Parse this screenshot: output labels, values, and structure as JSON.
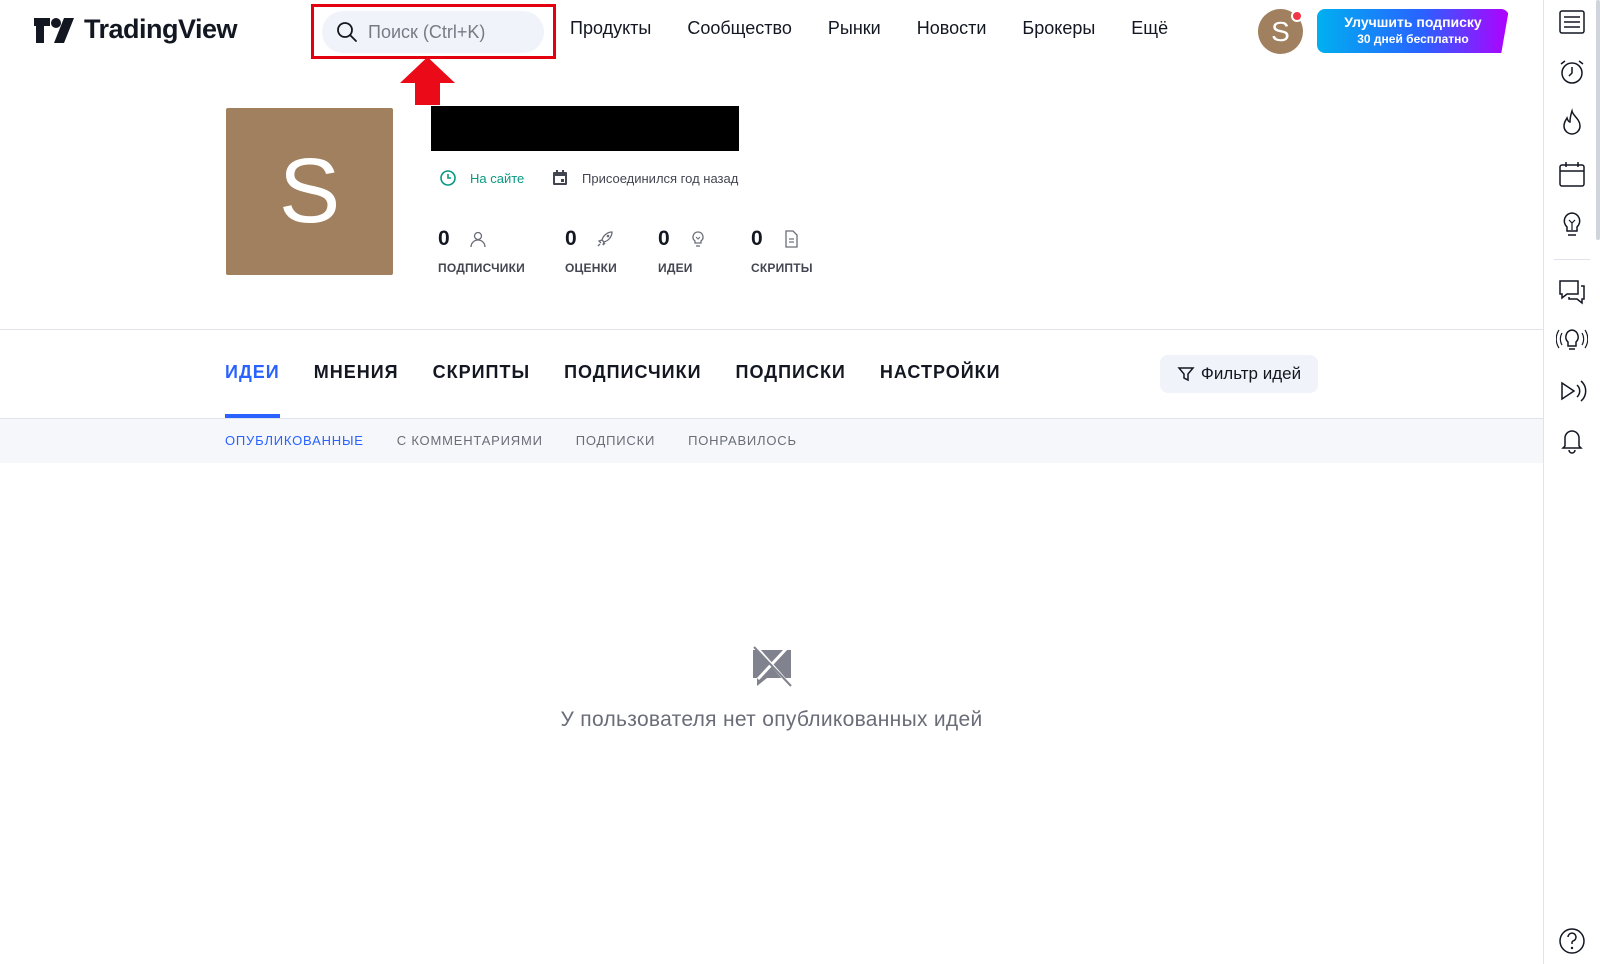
{
  "header": {
    "logo_text": "TradingView",
    "search_placeholder": "Поиск (Ctrl+K)",
    "nav": [
      "Продукты",
      "Сообщество",
      "Рынки",
      "Новости",
      "Брокеры",
      "Ещё"
    ],
    "user_initial": "S",
    "upgrade_line1": "Улучшить подписку",
    "upgrade_line2": "30 дней бесплатно"
  },
  "profile": {
    "avatar_initial": "S",
    "status_online": "На сайте",
    "joined": "Присоединился год назад",
    "stats": [
      {
        "value": "0",
        "label": "ПОДПИСЧИКИ",
        "icon": "person-icon"
      },
      {
        "value": "0",
        "label": "ОЦЕНКИ",
        "icon": "rocket-icon"
      },
      {
        "value": "0",
        "label": "ИДЕИ",
        "icon": "lightbulb-icon"
      },
      {
        "value": "0",
        "label": "СКРИПТЫ",
        "icon": "document-icon"
      }
    ]
  },
  "tabs": [
    "ИДЕИ",
    "МНЕНИЯ",
    "СКРИПТЫ",
    "ПОДПИСЧИКИ",
    "ПОДПИСКИ",
    "НАСТРОЙКИ"
  ],
  "filter_label": "Фильтр идей",
  "subtabs": [
    "ОПУБЛИКОВАННЫЕ",
    "С КОММЕНТАРИЯМИ",
    "ПОДПИСКИ",
    "ПОНРАВИЛОСЬ"
  ],
  "empty_message": "У пользователя нет опубликованных идей",
  "colors": {
    "accent": "#2962ff",
    "online": "#089981",
    "avatar": "#a0805e",
    "highlight": "#e3000f"
  }
}
